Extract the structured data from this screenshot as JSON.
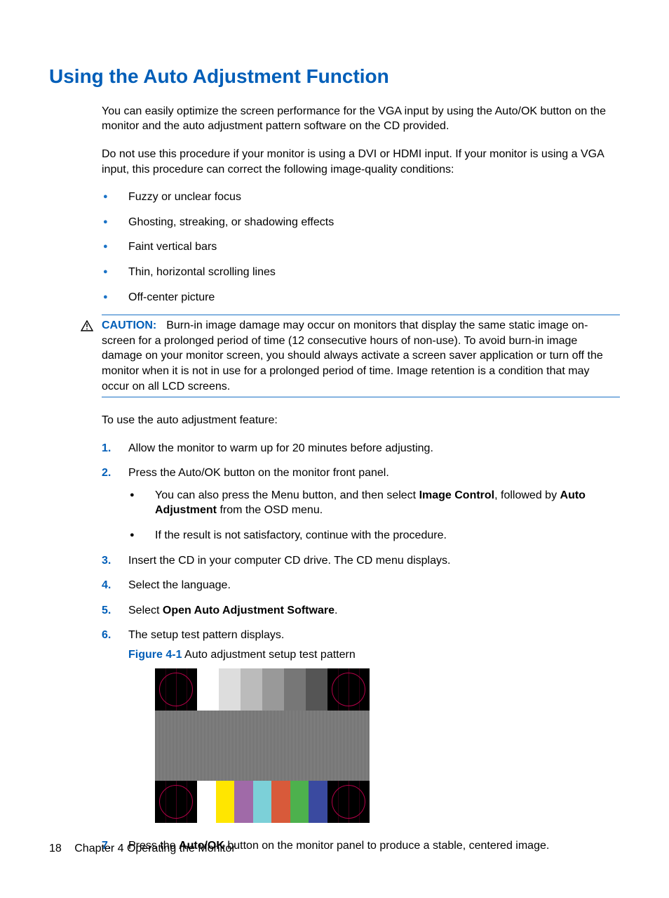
{
  "heading": "Using the Auto Adjustment Function",
  "intro1": "You can easily optimize the screen performance for the VGA input by using the Auto/OK button on the monitor and the auto adjustment pattern software on the CD provided.",
  "intro2": "Do not use this procedure if your monitor is using a DVI or HDMI input. If your monitor is using a VGA input, this procedure can correct the following image-quality conditions:",
  "bullets": [
    "Fuzzy or unclear focus",
    "Ghosting, streaking, or shadowing effects",
    "Faint vertical bars",
    "Thin, horizontal scrolling lines",
    "Off-center picture"
  ],
  "caution": {
    "label": "CAUTION:",
    "text": "Burn-in image damage may occur on monitors that display the same static image on-screen for a prolonged period of time (12 consecutive hours of non-use). To avoid burn-in image damage on your monitor screen, you should always activate a screen saver application or turn off the monitor when it is not in use for a prolonged period of time. Image retention is a condition that may occur on all LCD screens."
  },
  "feature_intro": "To use the auto adjustment feature:",
  "step1": "Allow the monitor to warm up for 20 minutes before adjusting.",
  "step2": "Press the Auto/OK button on the monitor front panel.",
  "step2_sub1_a": "You can also press the Menu button, and then select ",
  "step2_sub1_b": "Image Control",
  "step2_sub1_c": ", followed by ",
  "step2_sub1_d": "Auto Adjustment",
  "step2_sub1_e": " from the OSD menu.",
  "step2_sub2": "If the result is not satisfactory, continue with the procedure.",
  "step3": "Insert the CD in your computer CD drive. The CD menu displays.",
  "step4": "Select the language.",
  "step5_a": "Select ",
  "step5_b": "Open Auto Adjustment Software",
  "step5_c": ".",
  "step6": "The setup test pattern displays.",
  "figure_label": "Figure 4-1",
  "figure_caption": "  Auto adjustment setup test pattern",
  "step7_a": "Press the ",
  "step7_b": "Auto/OK",
  "step7_c": " button on the monitor panel to produce a stable, centered image.",
  "footer": {
    "page": "18",
    "chapter": "Chapter 4   Operating the Monitor"
  }
}
